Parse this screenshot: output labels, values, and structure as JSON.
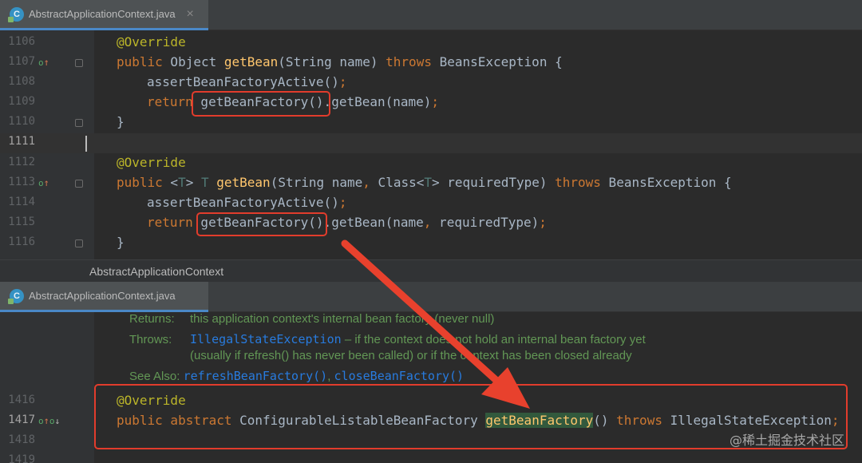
{
  "tab1": {
    "title": "AbstractApplicationContext.java",
    "icon": "c-class-icon"
  },
  "tab2": {
    "title": "AbstractApplicationContext.java",
    "icon": "c-class-icon"
  },
  "breadcrumb": "AbstractApplicationContext",
  "editor1": {
    "lines": [
      {
        "num": "1106",
        "text": "@Override"
      },
      {
        "num": "1107",
        "text": "public Object getBean(String name) throws BeansException {"
      },
      {
        "num": "1108",
        "text": "assertBeanFactoryActive();"
      },
      {
        "num": "1109",
        "text": "return getBeanFactory().getBean(name);"
      },
      {
        "num": "1110",
        "text": "}"
      },
      {
        "num": "1111",
        "text": ""
      },
      {
        "num": "1112",
        "text": "@Override"
      },
      {
        "num": "1113",
        "text": "public <T> T getBean(String name, Class<T> requiredType) throws BeansException {"
      },
      {
        "num": "1114",
        "text": "assertBeanFactoryActive();"
      },
      {
        "num": "1115",
        "text": "return getBeanFactory().getBean(name, requiredType);"
      },
      {
        "num": "1116",
        "text": "}"
      }
    ]
  },
  "doc": {
    "returns_label": "Returns:",
    "returns_text": "this application context's internal bean factory (never null)",
    "throws_label": "Throws:",
    "throws_link": "IllegalStateException",
    "throws_text": " – if the context does not hold an internal bean factory yet",
    "throws_text2": "(usually if refresh() has never been called) or if the context has been closed already",
    "see_label": "See Also:",
    "see_link1": "refreshBeanFactory()",
    "see_sep": ", ",
    "see_link2": "closeBeanFactory()"
  },
  "editor2": {
    "lines": [
      {
        "num": "1416",
        "text": "@Override"
      },
      {
        "num": "1417",
        "text": "public abstract ConfigurableListableBeanFactory getBeanFactory() throws IllegalStateException;"
      },
      {
        "num": "1418",
        "text": ""
      },
      {
        "num": "1419",
        "text": ""
      }
    ]
  },
  "watermark": "@稀土掘金技术社区",
  "colors": {
    "highlight_box": "#e23c2c",
    "arrow": "#e8412d",
    "keyword": "#cc7832",
    "annotation": "#bbb529",
    "method": "#ffc66d",
    "doc_text": "#629755",
    "doc_link": "#287bde"
  }
}
